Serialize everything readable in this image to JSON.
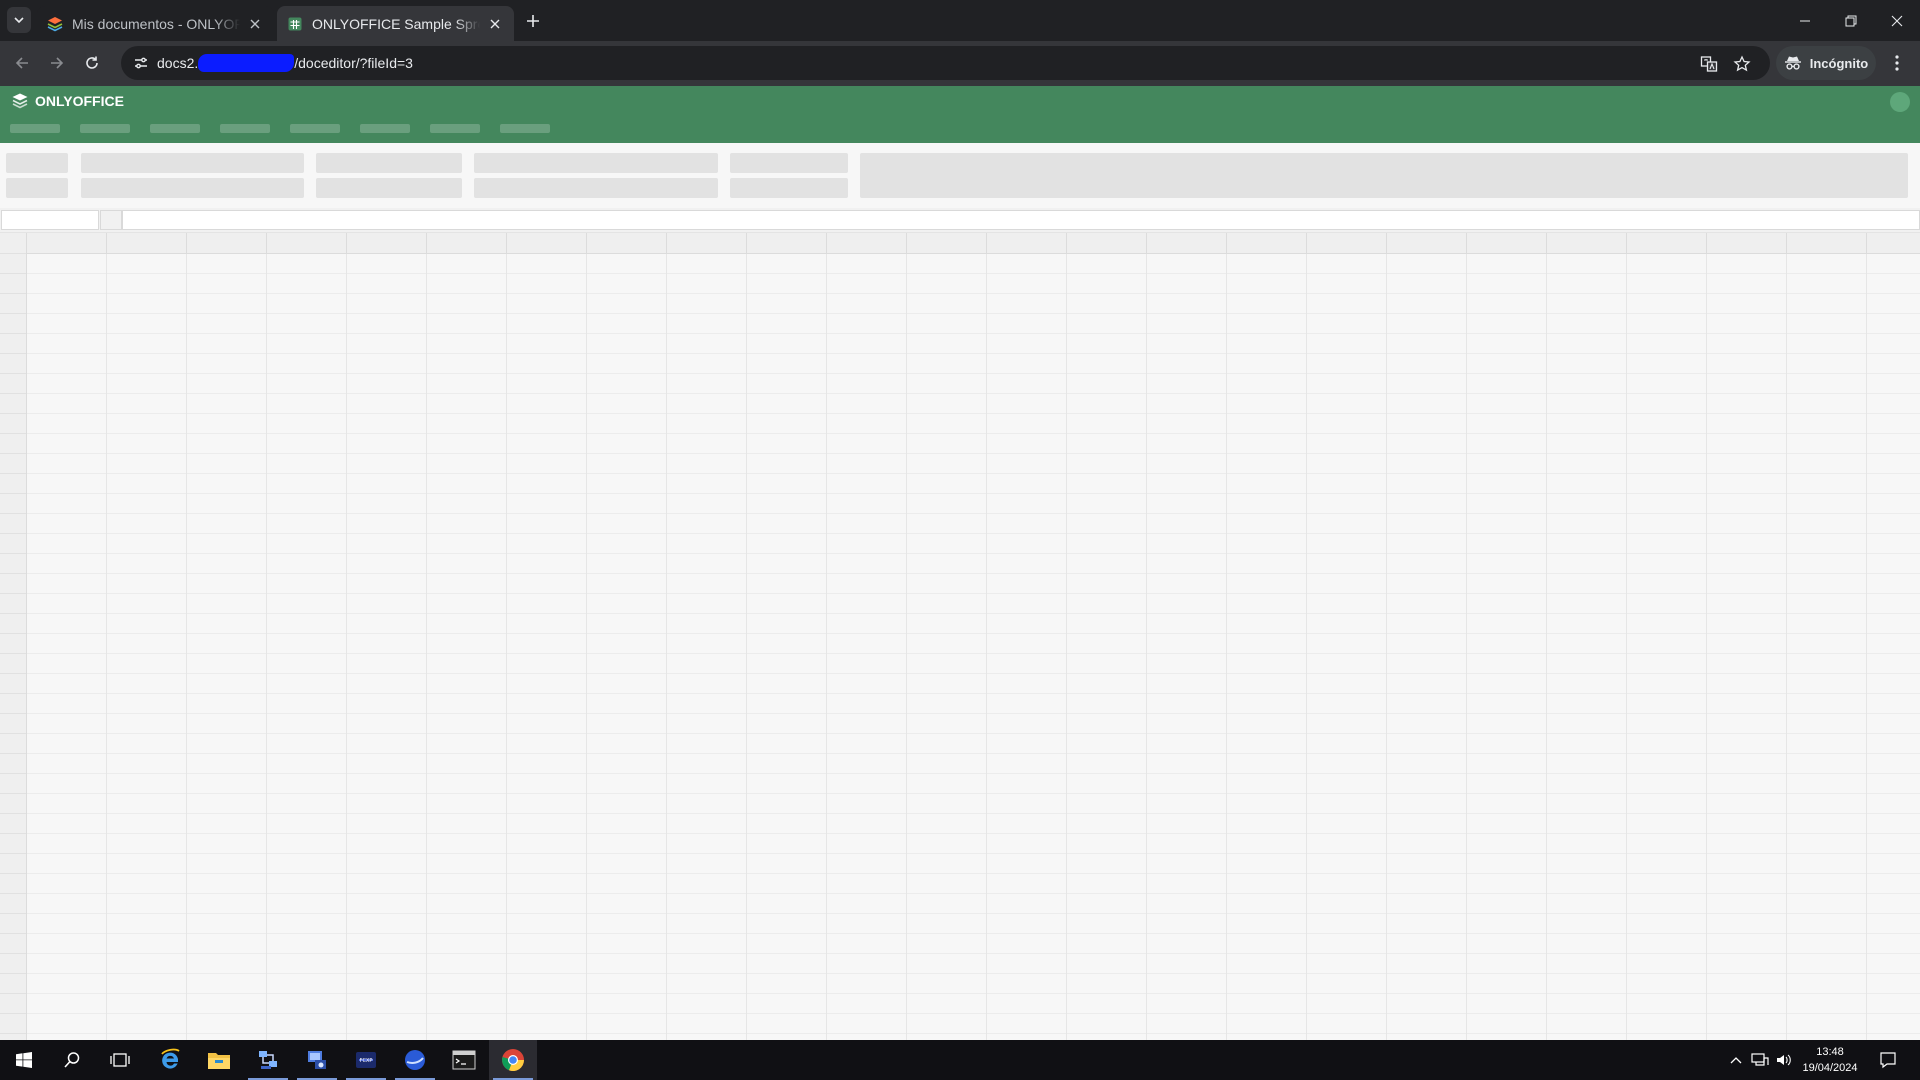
{
  "browser": {
    "tabs": [
      {
        "title": "Mis documentos - ONLYOFFICE",
        "icon": "onlyoffice-layers-icon",
        "active": false
      },
      {
        "title": "ONLYOFFICE Sample Spreadsheet",
        "icon": "spreadsheet-icon",
        "active": true
      }
    ],
    "url_prefix": "docs2.",
    "url_suffix": "/doceditor/?fileId=3",
    "incognito_label": "Incógnito"
  },
  "editor": {
    "brand": "ONLYOFFICE",
    "header_color": "#44875d",
    "loading": true
  },
  "taskbar": {
    "pinned_apps": [
      "internet-explorer-icon",
      "file-explorer-icon",
      "network-app-icon",
      "remote-desktop-icon",
      "vpn-app-icon",
      "browser-app-icon",
      "terminal-icon",
      "chrome-icon"
    ],
    "time": "13:48",
    "date": "19/04/2024"
  }
}
